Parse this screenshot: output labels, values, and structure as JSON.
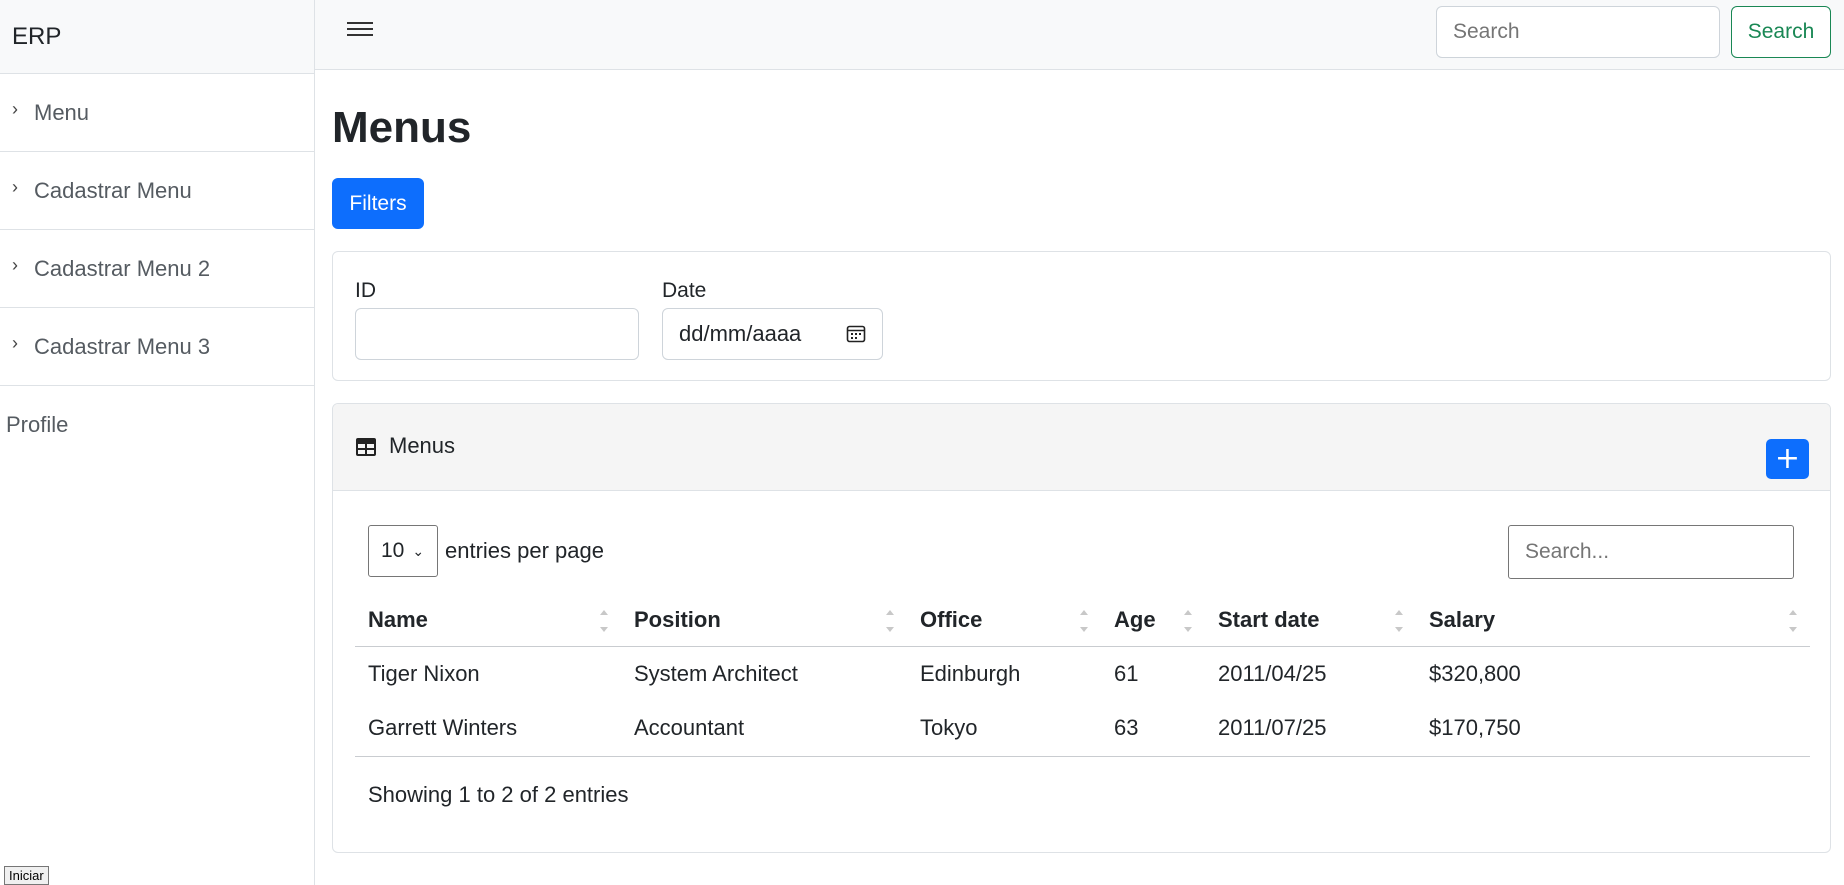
{
  "sidebar": {
    "brand": "ERP",
    "items": [
      {
        "label": "Menu"
      },
      {
        "label": "Cadastrar Menu"
      },
      {
        "label": "Cadastrar Menu 2"
      },
      {
        "label": "Cadastrar Menu 3"
      }
    ],
    "profile": "Profile",
    "start_button": "Iniciar"
  },
  "topbar": {
    "search_placeholder": "Search",
    "search_button": "Search",
    "menu_icon": "hamburger-icon"
  },
  "page": {
    "title": "Menus",
    "filters_button": "Filters"
  },
  "filters": {
    "id_label": "ID",
    "id_value": "",
    "date_label": "Date",
    "date_placeholder": "dd/mm/aaaa",
    "date_icon": "calendar-icon"
  },
  "table_card": {
    "title": "Menus",
    "title_icon": "table-icon",
    "add_label": "+",
    "per_page_value": "10",
    "per_page_label": "entries per page",
    "search_placeholder": "Search...",
    "columns": [
      "Name",
      "Position",
      "Office",
      "Age",
      "Start date",
      "Salary"
    ],
    "rows": [
      [
        "Tiger Nixon",
        "System Architect",
        "Edinburgh",
        "61",
        "2011/04/25",
        "$320,800"
      ],
      [
        "Garrett Winters",
        "Accountant",
        "Tokyo",
        "63",
        "2011/07/25",
        "$170,750"
      ]
    ],
    "info": "Showing 1 to 2 of 2 entries"
  },
  "colors": {
    "primary": "#0d6efd",
    "success": "#198754",
    "border": "#dee2e6",
    "header_bg": "#f8f9fa"
  }
}
